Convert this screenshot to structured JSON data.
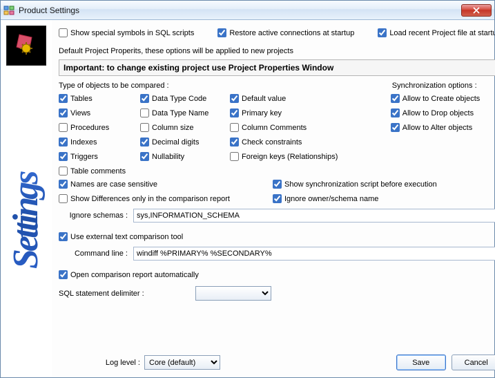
{
  "window": {
    "title": "Product Settings"
  },
  "sidebar": {
    "label": "Settings"
  },
  "top": {
    "show_special": {
      "label": "Show special symbols in SQL scripts",
      "checked": false
    },
    "restore_conn": {
      "label": "Restore active connections at startup",
      "checked": true
    },
    "load_recent": {
      "label": "Load recent Project file at startup",
      "checked": true
    }
  },
  "section_caption": "Default Project Properits, these options will be applied to new projects",
  "important": "Important: to change existing project use Project Properties Window",
  "headers": {
    "compare": "Type of objects to be compared :",
    "sync": "Synchronization options :"
  },
  "compare": {
    "tables": {
      "label": "Tables",
      "checked": true
    },
    "views": {
      "label": "Views",
      "checked": true
    },
    "procedures": {
      "label": "Procedures",
      "checked": false
    },
    "indexes": {
      "label": "Indexes",
      "checked": true
    },
    "triggers": {
      "label": "Triggers",
      "checked": true
    },
    "table_comments": {
      "label": "Table comments",
      "checked": false
    },
    "dt_code": {
      "label": "Data Type Code",
      "checked": true
    },
    "dt_name": {
      "label": "Data Type Name",
      "checked": false
    },
    "col_size": {
      "label": "Column size",
      "checked": false
    },
    "dec_digits": {
      "label": "Decimal digits",
      "checked": true
    },
    "nullability": {
      "label": "Nullability",
      "checked": true
    },
    "default_value": {
      "label": "Default value",
      "checked": true
    },
    "pk": {
      "label": "Primary key",
      "checked": true
    },
    "col_comments": {
      "label": "Column Comments",
      "checked": false
    },
    "check_constr": {
      "label": "Check constraints",
      "checked": true
    },
    "fk": {
      "label": "Foreign keys (Relationships)",
      "checked": false
    }
  },
  "sync": {
    "create": {
      "label": "Allow to Create objects",
      "checked": true
    },
    "drop": {
      "label": "Allow to Drop objects",
      "checked": true
    },
    "alter": {
      "label": "Allow to Alter objects",
      "checked": true
    }
  },
  "opts": {
    "case_sensitive": {
      "label": "Names are case sensitive",
      "checked": true
    },
    "show_sync_script": {
      "label": "Show synchronization script before execution",
      "checked": true
    },
    "diff_only": {
      "label": "Show Differences only in the comparison report",
      "checked": false
    },
    "ignore_owner": {
      "label": "Ignore owner/schema name",
      "checked": true
    }
  },
  "ignore_schemas": {
    "label": "Ignore schemas :",
    "value": "sys,INFORMATION_SCHEMA"
  },
  "ext_tool": {
    "use": {
      "label": "Use external text comparison tool",
      "checked": true
    },
    "cmd_label": "Command line :",
    "cmd_value": "windiff %PRIMARY% %SECONDARY%"
  },
  "open_report": {
    "label": "Open comparison report automatically",
    "checked": true
  },
  "sql_delim": {
    "label": "SQL statement delimiter :",
    "value": ""
  },
  "log_level": {
    "label": "Log level :",
    "value": "Core (default)"
  },
  "buttons": {
    "save": "Save",
    "cancel": "Cancel"
  }
}
